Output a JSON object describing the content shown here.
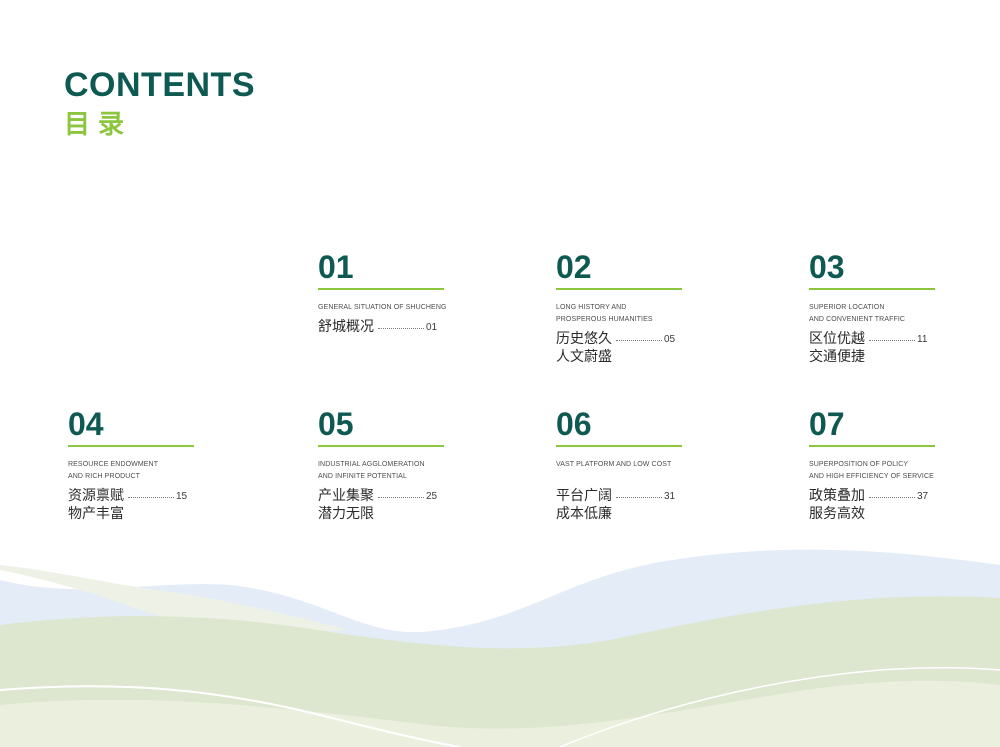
{
  "header": {
    "title_en": "CONTENTS",
    "title_cn": "目录"
  },
  "entries": [
    {
      "num": "01",
      "en1": "GENERAL SITUATION OF SHUCHENG",
      "en2": "",
      "cn1": "舒城概况",
      "cn2": "",
      "page": "01"
    },
    {
      "num": "02",
      "en1": "LONG HISTORY AND",
      "en2": "PROSPEROUS HUMANITIES",
      "cn1": "历史悠久",
      "cn2": "人文蔚盛",
      "page": "05"
    },
    {
      "num": "03",
      "en1": "SUPERIOR LOCATION",
      "en2": "AND CONVENIENT TRAFFIC",
      "cn1": "区位优越",
      "cn2": "交通便捷",
      "page": "11"
    },
    {
      "num": "04",
      "en1": "RESOURCE ENDOWMENT",
      "en2": "AND RICH PRODUCT",
      "cn1": "资源禀赋",
      "cn2": "物产丰富",
      "page": "15"
    },
    {
      "num": "05",
      "en1": "INDUSTRIAL AGGLOMERATION",
      "en2": "AND INFINITE POTENTIAL",
      "cn1": "产业集聚",
      "cn2": "潜力无限",
      "page": "25"
    },
    {
      "num": "06",
      "en1": "VAST PLATFORM AND LOW COST",
      "en2": "",
      "cn1": "平台广阔",
      "cn2": "成本低廉",
      "page": "31"
    },
    {
      "num": "07",
      "en1": "SUPERPOSITION OF POLICY",
      "en2": "AND HIGH EFFICIENCY OF SERVICE",
      "cn1": "政策叠加",
      "cn2": "服务高效",
      "page": "37"
    }
  ],
  "colors": {
    "primary": "#0e5a52",
    "accent": "#8cc63f",
    "wave_blue": "#e4ecf7",
    "wave_green": "#dde6cf"
  }
}
